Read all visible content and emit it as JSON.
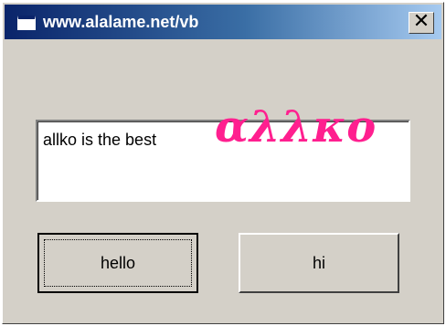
{
  "window": {
    "title": "www.alalame.net/vb",
    "close_symbol": "✕",
    "accent_color": "#0a246a"
  },
  "textbox": {
    "value": "allko is the best"
  },
  "logo": {
    "text": "αλλκο",
    "color": "#ff1f8f"
  },
  "buttons": {
    "hello_label": "hello",
    "hi_label": "hi"
  },
  "icons": {
    "app": "window-icon",
    "close": "close-icon"
  }
}
